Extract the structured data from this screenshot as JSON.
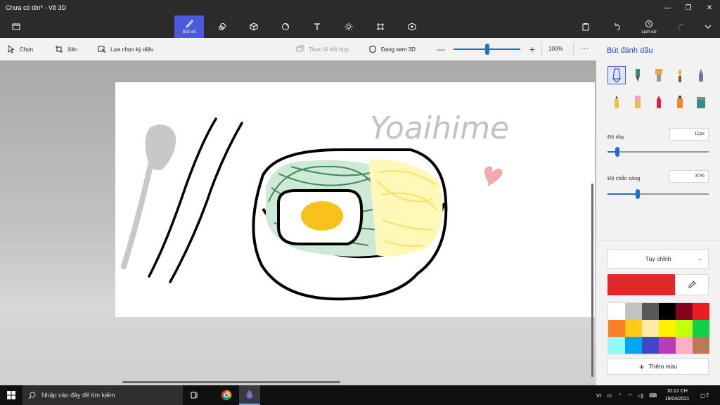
{
  "window": {
    "title": "Chưa có tên* - Vẽ 3D",
    "controls": [
      "—",
      "❐",
      "✕"
    ]
  },
  "main_toolbar": {
    "brushes_label": "Bút vẽ",
    "history_label": "Lịch sử"
  },
  "sub_toolbar": {
    "select": "Chọn",
    "crop": "Xén",
    "magic_select": "Lựa chọn kỳ diệu",
    "mixed_reality": "Thực tế kết hợp",
    "view_3d": "Đang xem 3D",
    "zoom_value": "100%",
    "zoom_fraction": 0.5,
    "more": "···"
  },
  "canvas": {
    "signature_text": "Yoaihime"
  },
  "right_panel": {
    "title": "Bút đánh dấu",
    "thickness_label": "Độ dày",
    "thickness_value": "11px",
    "thickness_fraction": 0.1,
    "opacity_label": "Độ chắn sáng",
    "opacity_value": "30%",
    "opacity_fraction": 0.3,
    "preset_dropdown": "Tùy chỉnh",
    "current_color": "#e02828",
    "add_color_label": "Thêm màu",
    "swatches": [
      "#ffffff",
      "#c3c3c3",
      "#585858",
      "#000000",
      "#88001b",
      "#ec1c24",
      "#ff7f27",
      "#ffca18",
      "#fdeca6",
      "#fff200",
      "#c4ff0e",
      "#0ed145",
      "#8cfffb",
      "#00a8f3",
      "#3f48cc",
      "#b83dba",
      "#ffaec8",
      "#b97a56"
    ]
  },
  "taskbar": {
    "search_placeholder": "Nhập vào đây để tìm kiếm",
    "lang": "VI",
    "time": "10:12 CH",
    "date": "19/04/2021",
    "notification_count": "2"
  }
}
